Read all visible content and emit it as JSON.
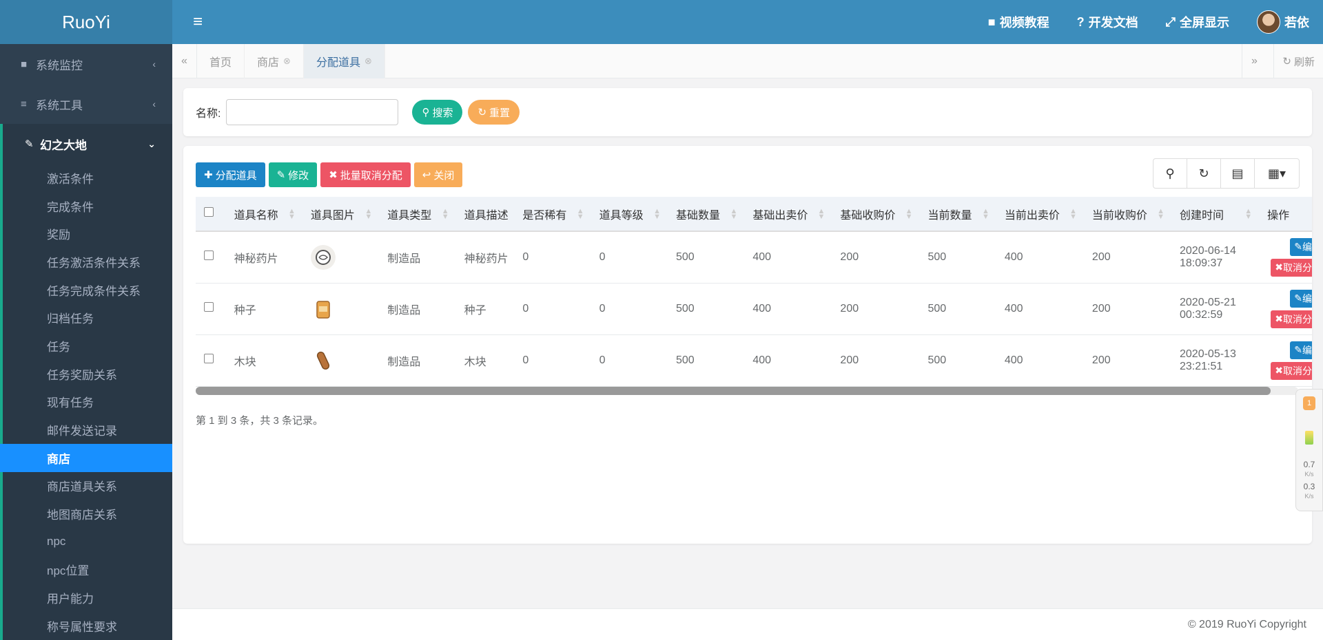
{
  "app": {
    "logo": "RuoYi"
  },
  "sidebar": {
    "top_items": [
      {
        "label": "系统监控",
        "icon": "video-camera-icon"
      },
      {
        "label": "系统工具",
        "icon": "list-icon"
      }
    ],
    "group": {
      "label": "幻之大地",
      "icon": "paint-brush-icon",
      "items": [
        {
          "label": "激活条件"
        },
        {
          "label": "完成条件"
        },
        {
          "label": "奖励"
        },
        {
          "label": "任务激活条件关系"
        },
        {
          "label": "任务完成条件关系"
        },
        {
          "label": "归档任务"
        },
        {
          "label": "任务"
        },
        {
          "label": "任务奖励关系"
        },
        {
          "label": "现有任务"
        },
        {
          "label": "邮件发送记录"
        },
        {
          "label": "商店",
          "active": true
        },
        {
          "label": "商店道具关系"
        },
        {
          "label": "地图商店关系"
        },
        {
          "label": "npc"
        },
        {
          "label": "npc位置"
        },
        {
          "label": "用户能力"
        },
        {
          "label": "称号属性要求"
        }
      ]
    }
  },
  "header": {
    "video_tutorial": "视频教程",
    "dev_docs": "开发文档",
    "fullscreen": "全屏显示",
    "username": "若依"
  },
  "tabs": {
    "items": [
      {
        "label": "首页",
        "closable": false,
        "active": false
      },
      {
        "label": "商店",
        "closable": true,
        "active": false
      },
      {
        "label": "分配道具",
        "closable": true,
        "active": true
      }
    ],
    "refresh_label": "刷新"
  },
  "search": {
    "name_label": "名称:",
    "name_value": "",
    "search_button": "搜索",
    "reset_button": "重置"
  },
  "toolbar": {
    "assign_button": "分配道具",
    "edit_button": "修改",
    "batch_cancel_button": "批量取消分配",
    "close_button": "关闭"
  },
  "table": {
    "columns": [
      "道具名称",
      "道具图片",
      "道具类型",
      "道具描述",
      "是否稀有",
      "道具等级",
      "基础数量",
      "基础出卖价",
      "基础收购价",
      "当前数量",
      "当前出卖价",
      "当前收购价",
      "创建时间",
      "操作"
    ],
    "rows": [
      {
        "name": "神秘药片",
        "image": "pill-icon",
        "type": "制造品",
        "desc": "神秘药片",
        "rare": "0",
        "level": "0",
        "base_qty": "500",
        "base_sell": "400",
        "base_buy": "200",
        "cur_qty": "500",
        "cur_sell": "400",
        "cur_buy": "200",
        "created_date": "2020-06-14",
        "created_time": "18:09:37"
      },
      {
        "name": "种子",
        "image": "seed-bag-icon",
        "type": "制造品",
        "desc": "种子",
        "rare": "0",
        "level": "0",
        "base_qty": "500",
        "base_sell": "400",
        "base_buy": "200",
        "cur_qty": "500",
        "cur_sell": "400",
        "cur_buy": "200",
        "created_date": "2020-05-21",
        "created_time": "00:32:59"
      },
      {
        "name": "木块",
        "image": "wood-log-icon",
        "type": "制造品",
        "desc": "木块",
        "rare": "0",
        "level": "0",
        "base_qty": "500",
        "base_sell": "400",
        "base_buy": "200",
        "cur_qty": "500",
        "cur_sell": "400",
        "cur_buy": "200",
        "created_date": "2020-05-13",
        "created_time": "23:21:51"
      }
    ],
    "row_edit_label": "编辑",
    "row_cancel_label": "取消分配",
    "pagination_text": "第 1 到 3 条，共 3 条记录。"
  },
  "float_widget": {
    "badge": "1",
    "upload_speed": "0.7",
    "download_speed": "0.3",
    "unit": "K/s"
  },
  "footer": {
    "copyright": "© 2019 RuoYi Copyright"
  },
  "colors": {
    "sidebar_bg": "#2f4050",
    "header_bg": "#3c8dbc",
    "active_menu": "#1890ff",
    "primary": "#1c84c6",
    "success": "#1ab394",
    "danger": "#ed5565",
    "warning": "#f8ac59"
  }
}
